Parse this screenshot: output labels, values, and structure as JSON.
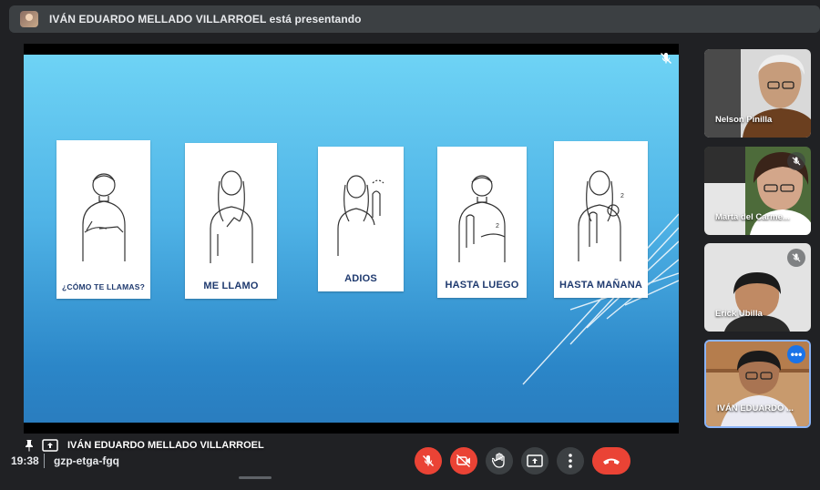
{
  "banner": {
    "text": "IVÁN EDUARDO MELLADO VILLARROEL está presentando",
    "icon": "presenter-avatar"
  },
  "presentation": {
    "presenter_name": "IVÁN EDUARDO MELLADO VILLARROEL",
    "cards": [
      {
        "caption": "¿CÓMO TE LLAMAS?"
      },
      {
        "caption": "ME LLAMO"
      },
      {
        "caption": "ADIOS"
      },
      {
        "caption": "HASTA LUEGO"
      },
      {
        "caption": "HASTA MAÑANA"
      }
    ]
  },
  "participants": [
    {
      "name": "Nelson Pinilla",
      "muted": false
    },
    {
      "name": "Marta del Carme...",
      "muted": true
    },
    {
      "name": "Erick Ubilla",
      "muted": true
    },
    {
      "name": "IVÁN EDUARDO ...",
      "muted": false,
      "active": true
    }
  ],
  "bottombar": {
    "time": "19:38",
    "meeting_code": "gzp-etga-fgq"
  },
  "colors": {
    "danger": "#ea4335",
    "control": "#3c4043",
    "accent": "#1a73e8",
    "background": "#202124"
  }
}
